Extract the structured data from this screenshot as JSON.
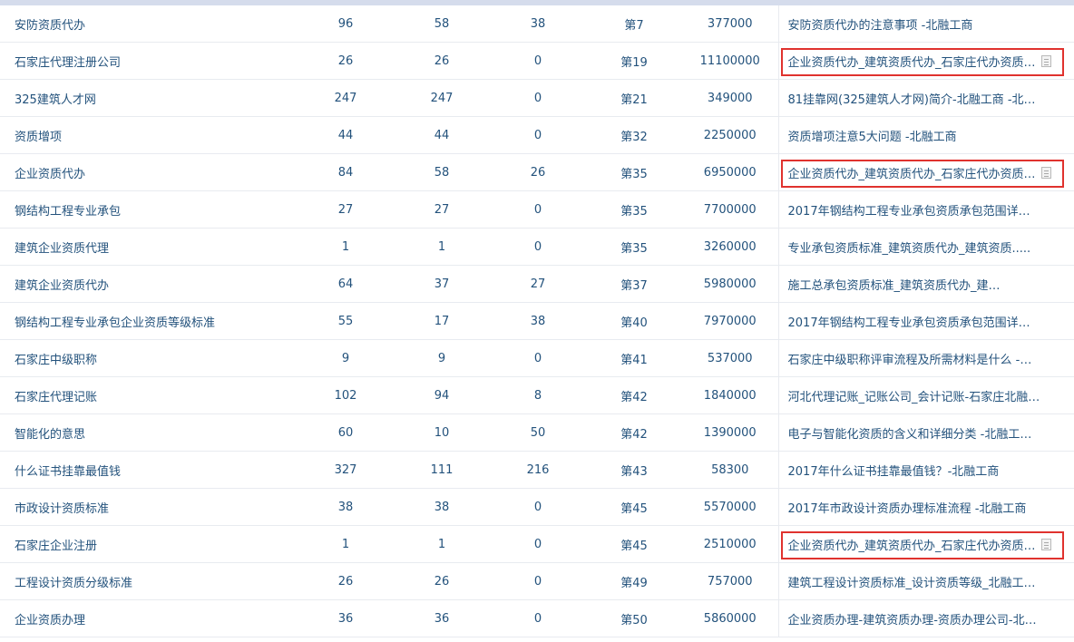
{
  "highlight_color": "#e0322e",
  "rows": [
    {
      "keyword": "安防资质代办",
      "c1": "96",
      "c2": "58",
      "c3": "38",
      "rank": "第7",
      "index": "377000",
      "title": "安防资质代办的注意事项 -北融工商",
      "doc_icon": false,
      "highlighted": false
    },
    {
      "keyword": "石家庄代理注册公司",
      "c1": "26",
      "c2": "26",
      "c3": "0",
      "rank": "第19",
      "index": "11100000",
      "title": "企业资质代办_建筑资质代办_石家庄代办资质…",
      "doc_icon": true,
      "highlighted": true
    },
    {
      "keyword": "325建筑人才网",
      "c1": "247",
      "c2": "247",
      "c3": "0",
      "rank": "第21",
      "index": "349000",
      "title": "81挂靠网(325建筑人才网)简介-北融工商 -北…",
      "doc_icon": false,
      "highlighted": false
    },
    {
      "keyword": "资质增项",
      "c1": "44",
      "c2": "44",
      "c3": "0",
      "rank": "第32",
      "index": "2250000",
      "title": "资质增项注意5大问题 -北融工商",
      "doc_icon": false,
      "highlighted": false
    },
    {
      "keyword": "企业资质代办",
      "c1": "84",
      "c2": "58",
      "c3": "26",
      "rank": "第35",
      "index": "6950000",
      "title": "企业资质代办_建筑资质代办_石家庄代办资质…",
      "doc_icon": true,
      "highlighted": true
    },
    {
      "keyword": "钢结构工程专业承包",
      "c1": "27",
      "c2": "27",
      "c3": "0",
      "rank": "第35",
      "index": "7700000",
      "title": "2017年钢结构工程专业承包资质承包范围详情…",
      "doc_icon": false,
      "highlighted": false
    },
    {
      "keyword": "建筑企业资质代理",
      "c1": "1",
      "c2": "1",
      "c3": "0",
      "rank": "第35",
      "index": "3260000",
      "title": "专业承包资质标准_建筑资质代办_建筑资质.....",
      "doc_icon": false,
      "highlighted": false
    },
    {
      "keyword": "建筑企业资质代办",
      "c1": "64",
      "c2": "37",
      "c3": "27",
      "rank": "第37",
      "index": "5980000",
      "title": "施工总承包资质标准_建筑资质代办_建…",
      "doc_icon": false,
      "highlighted": false
    },
    {
      "keyword": "钢结构工程专业承包企业资质等级标准",
      "c1": "55",
      "c2": "17",
      "c3": "38",
      "rank": "第40",
      "index": "7970000",
      "title": "2017年钢结构工程专业承包资质承包范围详情…",
      "doc_icon": false,
      "highlighted": false
    },
    {
      "keyword": "石家庄中级职称",
      "c1": "9",
      "c2": "9",
      "c3": "0",
      "rank": "第41",
      "index": "537000",
      "title": "石家庄中级职称评审流程及所需材料是什么 -…",
      "doc_icon": false,
      "highlighted": false
    },
    {
      "keyword": "石家庄代理记账",
      "c1": "102",
      "c2": "94",
      "c3": "8",
      "rank": "第42",
      "index": "1840000",
      "title": "河北代理记账_记账公司_会计记账-石家庄北融…",
      "doc_icon": false,
      "highlighted": false
    },
    {
      "keyword": "智能化的意思",
      "c1": "60",
      "c2": "10",
      "c3": "50",
      "rank": "第42",
      "index": "1390000",
      "title": "电子与智能化资质的含义和详细分类 -北融工…",
      "doc_icon": false,
      "highlighted": false
    },
    {
      "keyword": "什么证书挂靠最值钱",
      "c1": "327",
      "c2": "111",
      "c3": "216",
      "rank": "第43",
      "index": "58300",
      "title": "2017年什么证书挂靠最值钱？-北融工商",
      "doc_icon": false,
      "highlighted": false
    },
    {
      "keyword": "市政设计资质标准",
      "c1": "38",
      "c2": "38",
      "c3": "0",
      "rank": "第45",
      "index": "5570000",
      "title": "2017年市政设计资质办理标准流程 -北融工商",
      "doc_icon": false,
      "highlighted": false
    },
    {
      "keyword": "石家庄企业注册",
      "c1": "1",
      "c2": "1",
      "c3": "0",
      "rank": "第45",
      "index": "2510000",
      "title": "企业资质代办_建筑资质代办_石家庄代办资质…",
      "doc_icon": true,
      "highlighted": true
    },
    {
      "keyword": "工程设计资质分级标准",
      "c1": "26",
      "c2": "26",
      "c3": "0",
      "rank": "第49",
      "index": "757000",
      "title": "建筑工程设计资质标准_设计资质等级_北融工…",
      "doc_icon": false,
      "highlighted": false
    },
    {
      "keyword": "企业资质办理",
      "c1": "36",
      "c2": "36",
      "c3": "0",
      "rank": "第50",
      "index": "5860000",
      "title": "企业资质办理-建筑资质办理-资质办理公司-北…",
      "doc_icon": false,
      "highlighted": false
    }
  ]
}
